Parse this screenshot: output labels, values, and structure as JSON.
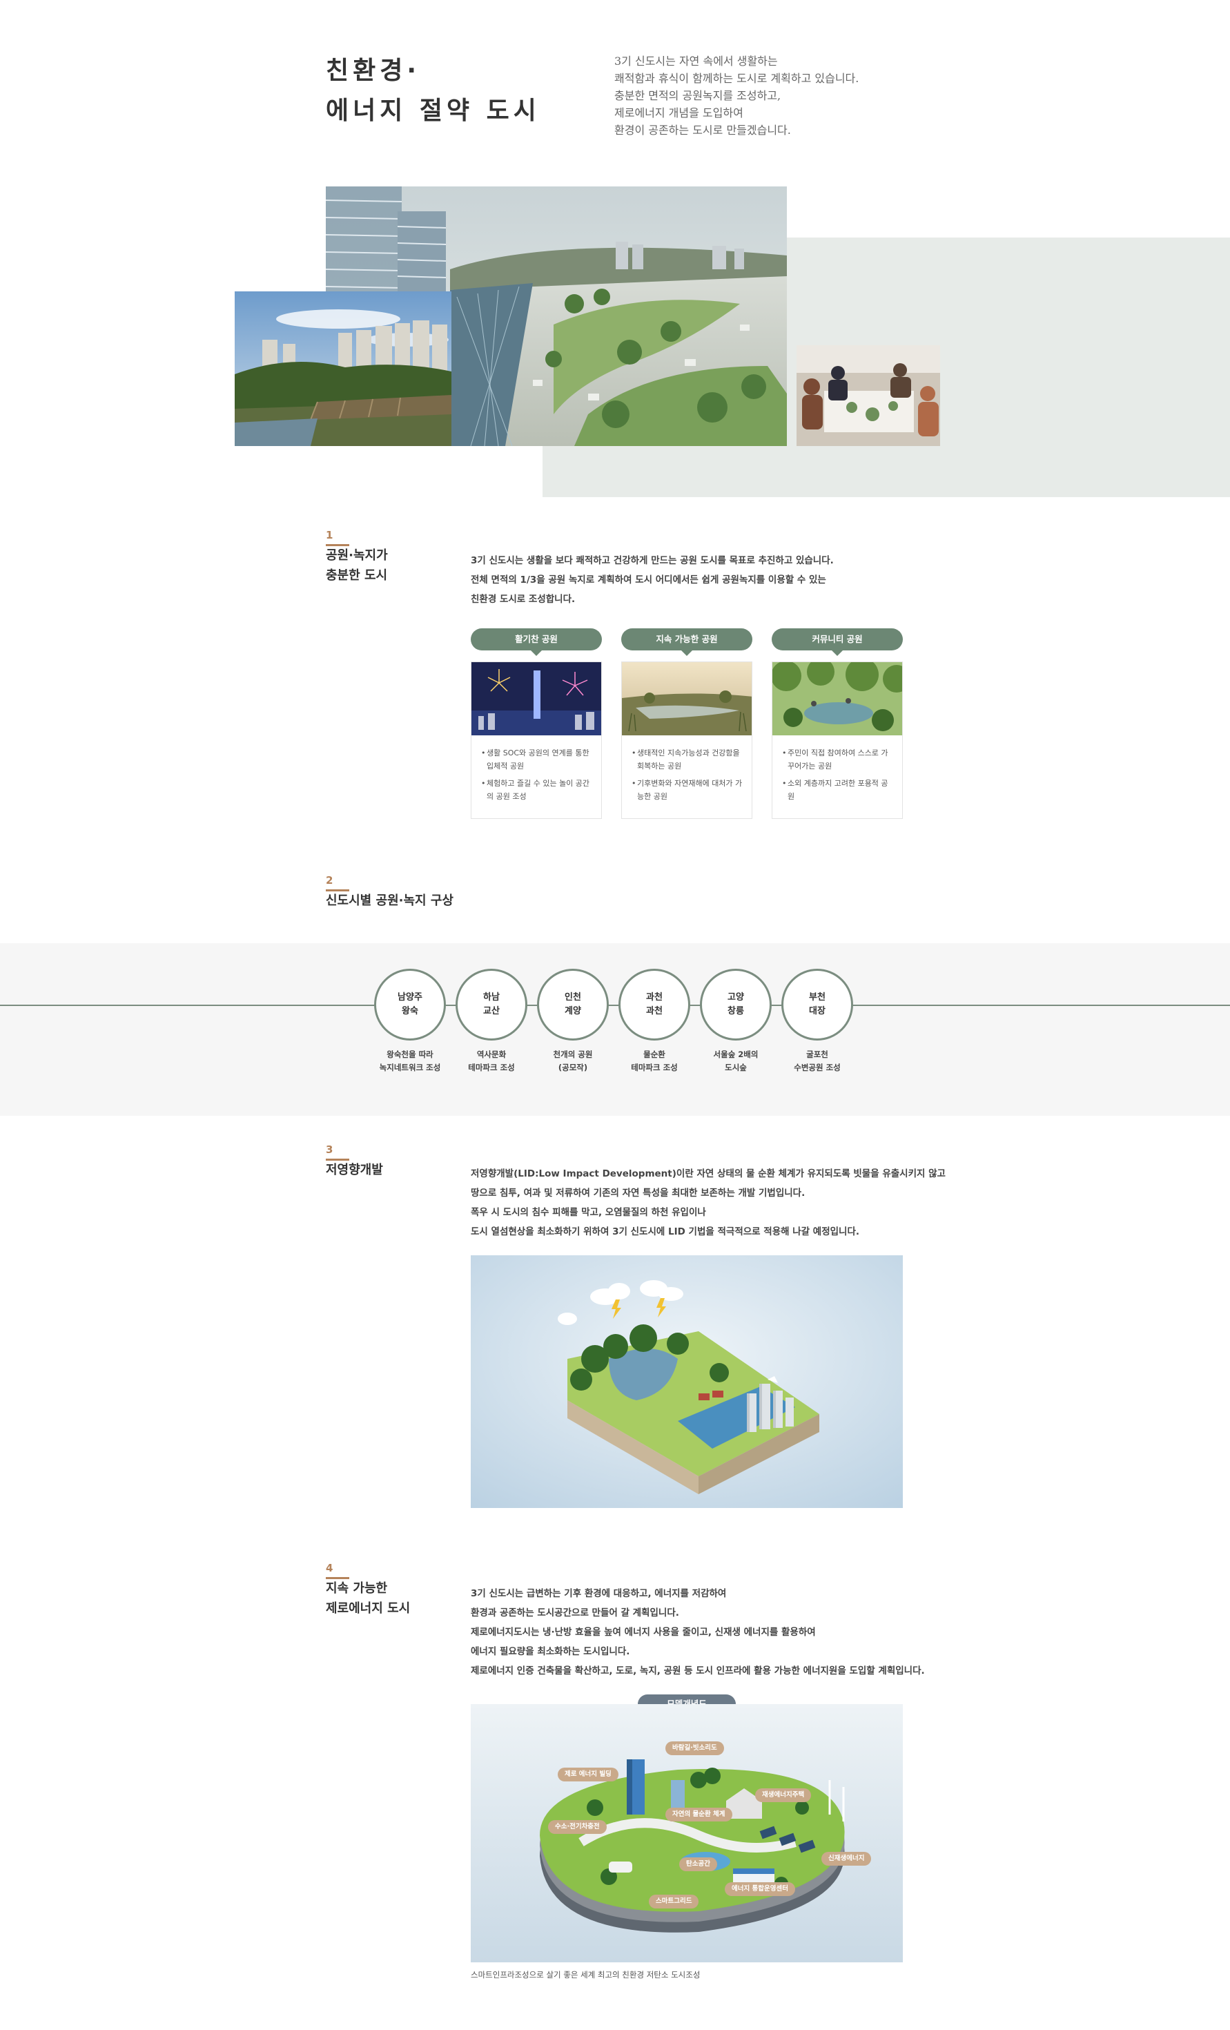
{
  "hero": {
    "title_line1": "친환경·",
    "title_line2": "에너지 절약 도시",
    "desc": [
      "3기 신도시는 자연 속에서 생활하는",
      "쾌적함과 휴식이 함께하는 도시로 계획하고 있습니다.",
      "충분한 면적의 공원녹지를 조성하고,",
      "제로에너지 개념을 도입하여",
      "환경이 공존하는 도시로 만들겠습니다."
    ]
  },
  "section1": {
    "num": "1",
    "title_line1": "공원·녹지가",
    "title_line2": "충분한 도시",
    "para": [
      "3기 신도시는 생활을 보다 쾌적하고 건강하게 만드는 공원 도시를 목표로 추진하고 있습니다.",
      "전체 면적의 1/3을 공원 녹지로 계획하여 도시 어디에서든 쉽게 공원녹지를 이용할 수 있는",
      "친환경 도시로 조성합니다."
    ],
    "cards": [
      {
        "label": "활기찬 공원",
        "bullets": [
          "생활 SOC와 공원의 연계를 통한 입체적 공원",
          "체험하고 즐길 수 있는 놀이 공간의 공원 조성"
        ]
      },
      {
        "label": "지속 가능한 공원",
        "bullets": [
          "생태적인 지속가능성과 건강함을 회복하는 공원",
          "기후변화와 자연재해에 대처가 가능한 공원"
        ]
      },
      {
        "label": "커뮤니티 공원",
        "bullets": [
          "주민이 직접 참여하여 스스로 가꾸어가는 공원",
          "소외 계층까지 고려한 포용적 공원"
        ]
      }
    ]
  },
  "section2": {
    "num": "2",
    "title": "신도시별 공원·녹지 구상",
    "cities": [
      {
        "name1": "남양주",
        "name2": "왕숙",
        "cap1": "왕숙천을 따라",
        "cap2": "녹지네트워크 조성"
      },
      {
        "name1": "하남",
        "name2": "교산",
        "cap1": "역사문화",
        "cap2": "테마파크 조성"
      },
      {
        "name1": "인천",
        "name2": "계양",
        "cap1": "천개의 공원",
        "cap2": "(공모작)"
      },
      {
        "name1": "과천",
        "name2": "과천",
        "cap1": "물순환",
        "cap2": "테마파크 조성"
      },
      {
        "name1": "고양",
        "name2": "창릉",
        "cap1": "서울숲 2배의",
        "cap2": "도시숲"
      },
      {
        "name1": "부천",
        "name2": "대장",
        "cap1": "굴포천",
        "cap2": "수변공원 조성"
      }
    ]
  },
  "section3": {
    "num": "3",
    "title": "저영향개발",
    "para": [
      "저영향개발(LID:Low Impact Development)이란 자연 상태의 물 순환 체계가 유지되도록 빗물을 유출시키지 않고",
      "땅으로 침투, 여과 및 저류하여 기존의 자연 특성을 최대한 보존하는 개발 기법입니다.",
      "폭우 시 도시의 침수 피해를 막고, 오염물질의 하천 유입이나",
      "도시 열섬현상을 최소화하기 위하여 3기 신도시에 LID 기법을 적극적으로 적용해 나갈 예정입니다."
    ]
  },
  "section4": {
    "num": "4",
    "title_line1": "지속 가능한",
    "title_line2": "제로에너지 도시",
    "para": [
      "3기 신도시는 급변하는 기후 환경에 대응하고, 에너지를 저감하여",
      "환경과 공존하는 도시공간으로 만들어 갈 계획입니다.",
      "제로에너지도시는 냉·난방 효율을 높여 에너지 사용을 줄이고, 신재생 에너지를 활용하여",
      "에너지 필요량을 최소화하는 도시입니다.",
      "제로에너지 인증 건축물을 확산하고, 도로, 녹지, 공원 등 도시 인프라에 활용 가능한 에너지원을 도입할 계획입니다."
    ],
    "diagram_label": "모델개념도",
    "tags": [
      "바람길·빗소리도",
      "제로 에너지 빌딩",
      "재생에너지주택",
      "수소·전기차충전",
      "자연의 물순환 체계",
      "신재생에너지",
      "탄소공간",
      "에너지 통합운영센터",
      "스마트그리드"
    ],
    "caption": "스마트인프라조성으로 살기 좋은 세계 최고의 친환경 저탄소 도시조성"
  }
}
